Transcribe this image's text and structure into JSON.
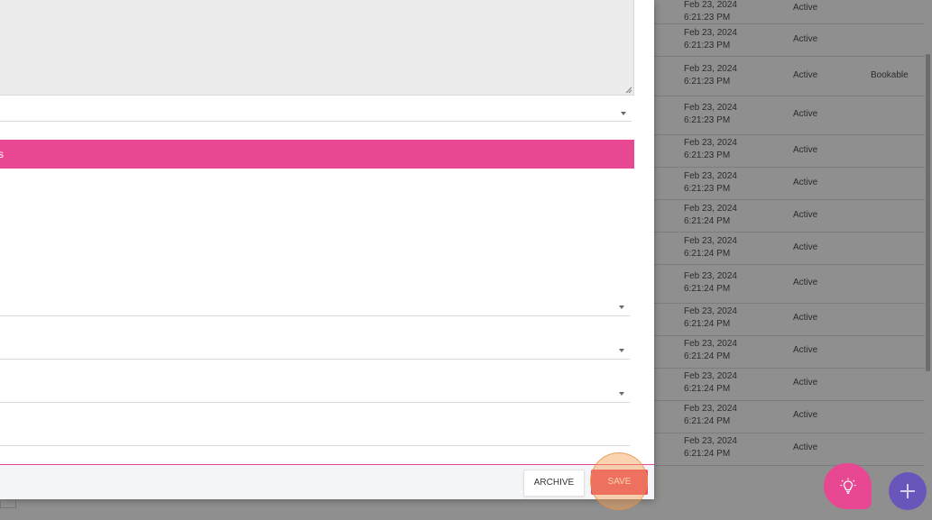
{
  "background_table": {
    "rows": [
      {
        "date": "Feb 23, 2024",
        "time": "6:21:23 PM",
        "status": "Active",
        "bookable": ""
      },
      {
        "date": "Feb 23, 2024",
        "time": "6:21:23 PM",
        "status": "Active",
        "bookable": ""
      },
      {
        "date": "Feb 23, 2024",
        "time": "6:21:23 PM",
        "status": "Active",
        "bookable": "Bookable"
      },
      {
        "date": "Feb 23, 2024",
        "time": "6:21:23 PM",
        "status": "Active",
        "bookable": ""
      },
      {
        "date": "Feb 23, 2024",
        "time": "6:21:23 PM",
        "status": "Active",
        "bookable": ""
      },
      {
        "date": "Feb 23, 2024",
        "time": "6:21:23 PM",
        "status": "Active",
        "bookable": ""
      },
      {
        "date": "Feb 23, 2024",
        "time": "6:21:24 PM",
        "status": "Active",
        "bookable": ""
      },
      {
        "date": "Feb 23, 2024",
        "time": "6:21:24 PM",
        "status": "Active",
        "bookable": ""
      },
      {
        "date": "Feb 23, 2024",
        "time": "6:21:24 PM",
        "status": "Active",
        "bookable": ""
      },
      {
        "date": "Feb 23, 2024",
        "time": "6:21:24 PM",
        "status": "Active",
        "bookable": ""
      },
      {
        "date": "Feb 23, 2024",
        "time": "6:21:24 PM",
        "status": "Active",
        "bookable": ""
      },
      {
        "date": "Feb 23, 2024",
        "time": "6:21:24 PM",
        "status": "Active",
        "bookable": ""
      },
      {
        "date": "Feb 23, 2024",
        "time": "6:21:24 PM",
        "status": "Active",
        "bookable": ""
      },
      {
        "date": "Feb 23, 2024",
        "time": "6:21:24 PM",
        "status": "Active",
        "bookable": ""
      }
    ]
  },
  "modal": {
    "section_header": "s",
    "footer": {
      "archive_label": "ARCHIVE",
      "save_label": "SAVE"
    }
  },
  "fabs": {
    "idea_icon": "lightbulb-icon",
    "add_icon": "plus-icon"
  },
  "colors": {
    "accent_pink": "#e84791",
    "save_red": "#e94a6a",
    "fab_purple": "#6a56bb"
  }
}
